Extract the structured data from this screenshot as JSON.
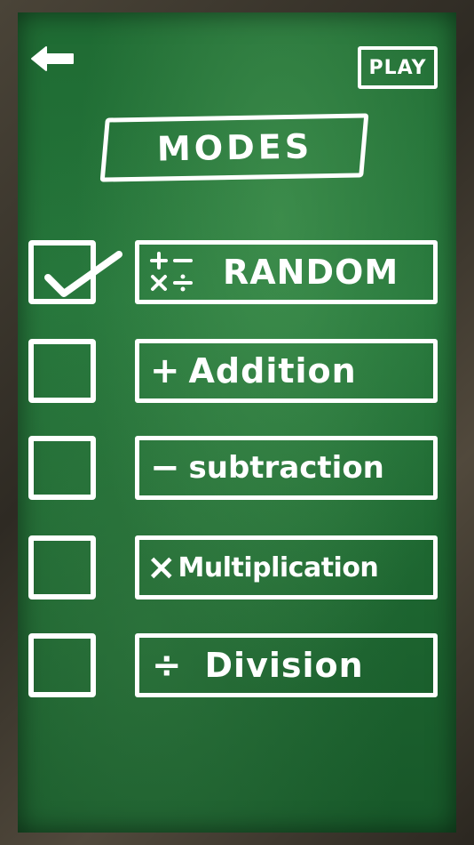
{
  "header": {
    "back_icon": "arrow-left-icon",
    "play_label": "PLAY"
  },
  "title": "MODES",
  "modes": [
    {
      "symbol": "+−×÷",
      "label": "RANDOM",
      "checked": true
    },
    {
      "symbol": "+",
      "label": "Addition",
      "checked": false
    },
    {
      "symbol": "−",
      "label": "subtraction",
      "checked": false
    },
    {
      "symbol": "×",
      "label": "Multiplication",
      "checked": false
    },
    {
      "symbol": "÷",
      "label": "Division",
      "checked": false
    }
  ],
  "colors": {
    "chalkboard": "#1f6b33",
    "frame": "#3a352c",
    "chalk": "#ffffff"
  }
}
